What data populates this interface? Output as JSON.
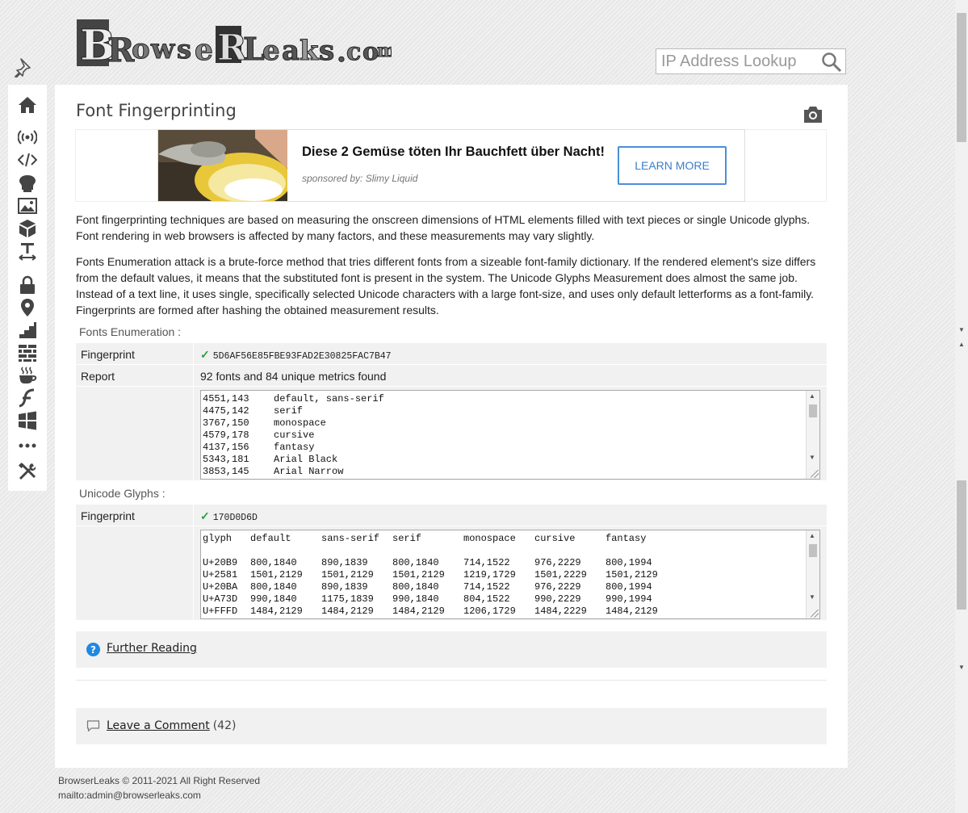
{
  "header": {
    "logo_text": "BrowserLeaks.com",
    "search_placeholder": "IP Address Lookup"
  },
  "sidebar": {
    "items": [
      {
        "icon": "home-icon"
      },
      {
        "icon": "radio-signal-icon"
      },
      {
        "icon": "code-icon"
      },
      {
        "icon": "webgl-icon"
      },
      {
        "icon": "image-icon"
      },
      {
        "icon": "cube-icon"
      },
      {
        "icon": "font-size-icon"
      },
      {
        "icon": "lock-icon"
      },
      {
        "icon": "location-pin-icon"
      },
      {
        "icon": "stairs-icon"
      },
      {
        "icon": "brick-wall-icon"
      },
      {
        "icon": "java-cup-icon"
      },
      {
        "icon": "flash-icon"
      },
      {
        "icon": "windows-icon"
      },
      {
        "icon": "more-dots-icon"
      },
      {
        "icon": "tools-icon"
      }
    ]
  },
  "page": {
    "title": "Font Fingerprinting",
    "intro1": "Font fingerprinting techniques are based on measuring the onscreen dimensions of HTML elements filled with text pieces or single Unicode glyphs. Font rendering in web browsers is affected by many factors, and these measurements may vary slightly.",
    "intro2": "Fonts Enumeration attack is a brute-force method that tries different fonts from a sizeable font-family dictionary. If the rendered element's size differs from the default values, it means that the substituted font is present in the system. The Unicode Glyphs Measurement does almost the same job. Instead of a text line, it uses single, specifically selected Unicode characters with a large font-size, and uses only default letterforms as a font-family. Fingerprints are formed after hashing the obtained measurement results."
  },
  "ad": {
    "headline": "Diese 2 Gemüse töten Ihr Bauchfett über Nacht!",
    "sponsor": "sponsored by: Slimy Liquid",
    "button": "LEARN MORE"
  },
  "fonts_enum": {
    "section_label": "Fonts Enumeration :",
    "fingerprint_label": "Fingerprint",
    "fingerprint_value": "5D6AF56E85FBE93FAD2E30825FAC7B47",
    "report_label": "Report",
    "report_value": "92 fonts and 84 unique metrics found",
    "lines": [
      {
        "metric": "4551,143",
        "font": "default, sans-serif"
      },
      {
        "metric": "4475,142",
        "font": "serif"
      },
      {
        "metric": "3767,150",
        "font": "monospace"
      },
      {
        "metric": "4579,178",
        "font": "cursive"
      },
      {
        "metric": "4137,156",
        "font": "fantasy"
      },
      {
        "metric": "5343,181",
        "font": "Arial Black"
      },
      {
        "metric": "3853,145",
        "font": "Arial Narrow"
      }
    ]
  },
  "unicode": {
    "section_label": "Unicode Glyphs :",
    "fingerprint_label": "Fingerprint",
    "fingerprint_value": "170D0D6D",
    "headers": [
      "glyph",
      "default",
      "sans-serif",
      "serif",
      "monospace",
      "cursive",
      "fantasy"
    ],
    "rows": [
      [
        "U+20B9",
        "800,1840",
        "890,1839",
        "800,1840",
        "714,1522",
        "976,2229",
        "800,1994"
      ],
      [
        "U+2581",
        "1501,2129",
        "1501,2129",
        "1501,2129",
        "1219,1729",
        "1501,2229",
        "1501,2129"
      ],
      [
        "U+20BA",
        "800,1840",
        "890,1839",
        "800,1840",
        "714,1522",
        "976,2229",
        "800,1994"
      ],
      [
        "U+A73D",
        "990,1840",
        "1175,1839",
        "990,1840",
        "804,1522",
        "990,2229",
        "990,1994"
      ],
      [
        "U+FFFD",
        "1484,2129",
        "1484,2129",
        "1484,2129",
        "1206,1729",
        "1484,2229",
        "1484,2129"
      ]
    ]
  },
  "further_reading": "Further Reading",
  "comment": {
    "label": "Leave a Comment",
    "count": "(42)"
  },
  "footer": {
    "copyright": "BrowserLeaks © 2011-2021 All Right Reserved",
    "email": "mailto:admin@browserleaks.com"
  }
}
